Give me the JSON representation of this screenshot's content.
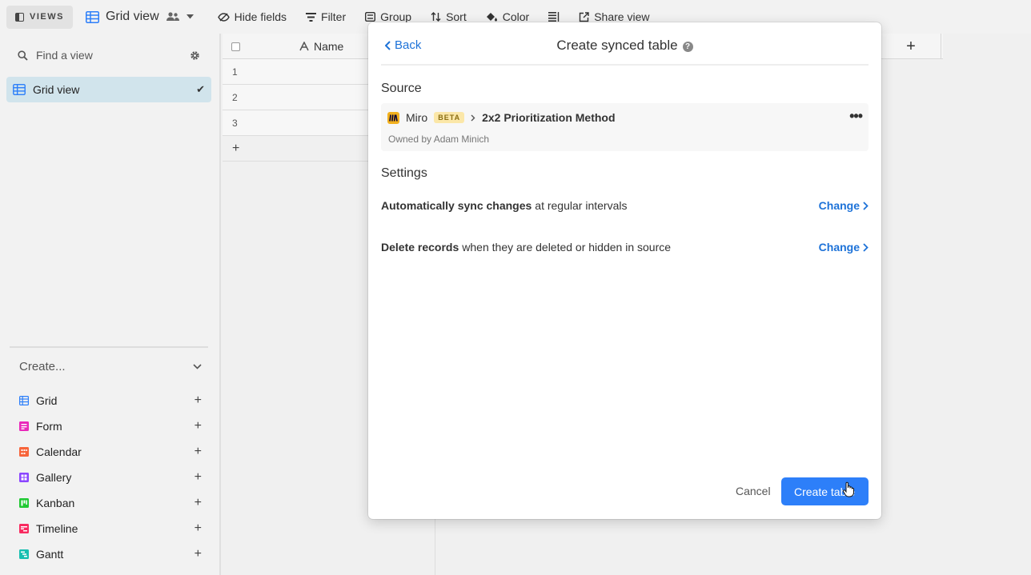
{
  "toolbar": {
    "views_label": "VIEWS",
    "view_name": "Grid view",
    "hide_fields": "Hide fields",
    "filter": "Filter",
    "group": "Group",
    "sort": "Sort",
    "color": "Color",
    "share_view": "Share view"
  },
  "sidebar": {
    "find_placeholder": "Find a view",
    "active_view": "Grid view",
    "create_label": "Create...",
    "create_items": [
      {
        "label": "Grid",
        "color": "#2d7ff9"
      },
      {
        "label": "Form",
        "color": "#e929ba"
      },
      {
        "label": "Calendar",
        "color": "#f7653b"
      },
      {
        "label": "Gallery",
        "color": "#8b46ff"
      },
      {
        "label": "Kanban",
        "color": "#20c933"
      },
      {
        "label": "Timeline",
        "color": "#f82b60"
      },
      {
        "label": "Gantt",
        "color": "#18bfb1"
      }
    ]
  },
  "grid": {
    "name_header": "Name",
    "rows": [
      "1",
      "2",
      "3"
    ],
    "add_row": "+",
    "add_column": "+"
  },
  "modal": {
    "back": "Back",
    "title": "Create synced table",
    "help": "?",
    "source_title": "Source",
    "source_app": "Miro",
    "beta_badge": "BETA",
    "source_name": "2x2 Prioritization Method",
    "owned_by": "Owned by Adam Minich",
    "more": "•••",
    "settings_title": "Settings",
    "setting1_bold": "Automatically sync changes",
    "setting1_rest": "at regular intervals",
    "setting2_bold": "Delete records",
    "setting2_rest": "when they are deleted or hidden in source",
    "change": "Change",
    "cancel": "Cancel",
    "create_button": "Create table"
  }
}
